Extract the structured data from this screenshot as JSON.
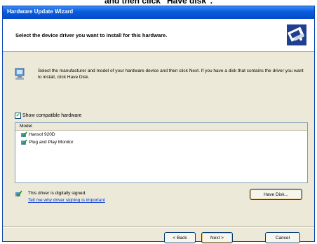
{
  "caption": "and then click \"Have disk\".",
  "window": {
    "title": "Hardware Update Wizard"
  },
  "header": {
    "headline": "Select the device driver you want to install for this hardware.",
    "icon": "hardware-wizard-icon"
  },
  "instructions": {
    "icon": "monitor-icon",
    "text": "Select the manufacturer and model of your hardware device and then click Next. If you have a disk that contains the driver you want to install, click Have Disk."
  },
  "compatible_checkbox": {
    "checked": true,
    "label": "Show compatible hardware"
  },
  "model_list": {
    "header": "Model",
    "items": [
      {
        "label": "Hansol 920D",
        "icon": "driver-icon"
      },
      {
        "label": "Plug and Play Monitor",
        "icon": "driver-icon"
      }
    ]
  },
  "signature": {
    "icon": "signed-driver-icon",
    "text": "This driver is digitally signed.",
    "link": "Tell me why driver signing is important"
  },
  "buttons": {
    "have_disk": "Have Disk...",
    "back": "< Back",
    "next": "Next >",
    "cancel": "Cancel"
  }
}
